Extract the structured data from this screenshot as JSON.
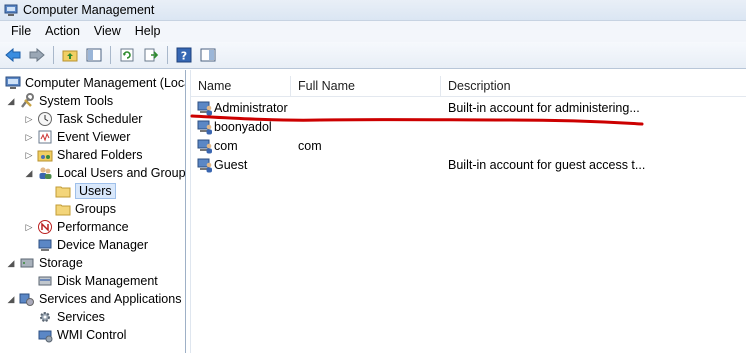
{
  "window": {
    "title": "Computer Management"
  },
  "menu": [
    "File",
    "Action",
    "View",
    "Help"
  ],
  "tree": [
    {
      "label": "Computer Management (Local",
      "level": 0,
      "expander": "",
      "icon": "computer-management-icon"
    },
    {
      "label": "System Tools",
      "level": 1,
      "expander": "◢",
      "icon": "system-tools-icon"
    },
    {
      "label": "Task Scheduler",
      "level": 2,
      "expander": "▷",
      "icon": "clock-icon"
    },
    {
      "label": "Event Viewer",
      "level": 2,
      "expander": "▷",
      "icon": "event-viewer-icon"
    },
    {
      "label": "Shared Folders",
      "level": 2,
      "expander": "▷",
      "icon": "shared-folder-icon"
    },
    {
      "label": "Local Users and Groups",
      "level": 2,
      "expander": "◢",
      "icon": "users-groups-icon"
    },
    {
      "label": "Users",
      "level": 3,
      "expander": "",
      "icon": "folder-icon",
      "selected": true
    },
    {
      "label": "Groups",
      "level": 3,
      "expander": "",
      "icon": "folder-icon"
    },
    {
      "label": "Performance",
      "level": 2,
      "expander": "▷",
      "icon": "performance-icon"
    },
    {
      "label": "Device Manager",
      "level": 2,
      "expander": "",
      "icon": "device-manager-icon"
    },
    {
      "label": "Storage",
      "level": 1,
      "expander": "◢",
      "icon": "storage-icon"
    },
    {
      "label": "Disk Management",
      "level": 2,
      "expander": "",
      "icon": "disk-management-icon"
    },
    {
      "label": "Services and Applications",
      "level": 1,
      "expander": "◢",
      "icon": "services-applications-icon"
    },
    {
      "label": "Services",
      "level": 2,
      "expander": "",
      "icon": "services-gear-icon"
    },
    {
      "label": "WMI Control",
      "level": 2,
      "expander": "",
      "icon": "wmi-control-icon"
    }
  ],
  "columns": {
    "name": "Name",
    "full_name": "Full Name",
    "description": "Description"
  },
  "users": [
    {
      "name": "Administrator",
      "full_name": "",
      "description": "Built-in account for administering..."
    },
    {
      "name": "boonyadol",
      "full_name": "",
      "description": ""
    },
    {
      "name": "com",
      "full_name": "com",
      "description": ""
    },
    {
      "name": "Guest",
      "full_name": "",
      "description": "Built-in account for guest access t..."
    }
  ],
  "colors": {
    "annotation": "#cc0000",
    "selection": "#d9e8fb",
    "title_bar": "#dbe6f3"
  }
}
